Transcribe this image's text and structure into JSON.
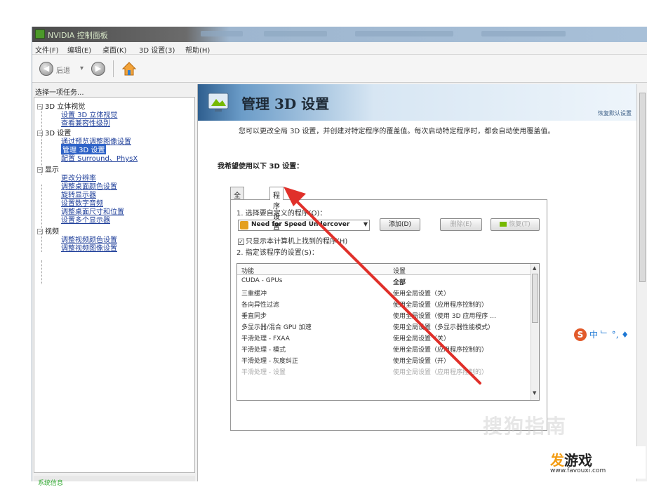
{
  "window": {
    "title": "NVIDIA 控制面板"
  },
  "menu": [
    "文件(F)",
    "编辑(E)",
    "桌面(K)",
    "3D 设置(3)",
    "帮助(H)"
  ],
  "toolbar": {
    "back_label": "后退",
    "back_glyph": "◀",
    "forward_glyph": "▶"
  },
  "tree": {
    "header": "选择一项任务...",
    "items": [
      {
        "label": "3D 立体视觉",
        "type": "category"
      },
      {
        "label": "设置 3D 立体视觉",
        "type": "link"
      },
      {
        "label": "查看兼容性级别",
        "type": "link"
      },
      {
        "label": "3D 设置",
        "type": "category"
      },
      {
        "label": "通过预览调整图像设置",
        "type": "link"
      },
      {
        "label": "管理 3D 设置",
        "type": "selected"
      },
      {
        "label": "配置 Surround、PhysX",
        "type": "link"
      },
      {
        "label": "显示",
        "type": "category"
      },
      {
        "label": "更改分辨率",
        "type": "link"
      },
      {
        "label": "调整桌面颜色设置",
        "type": "link"
      },
      {
        "label": "旋转显示器",
        "type": "link"
      },
      {
        "label": "设置数字音频",
        "type": "link"
      },
      {
        "label": "调整桌面尺寸和位置",
        "type": "link"
      },
      {
        "label": "设置多个显示器",
        "type": "link"
      },
      {
        "label": "视频",
        "type": "category"
      },
      {
        "label": "调整视频颜色设置",
        "type": "link"
      },
      {
        "label": "调整视频图像设置",
        "type": "link"
      }
    ],
    "expander_glyph": "−",
    "footer": "系统信息"
  },
  "main": {
    "title": "管理 3D 设置",
    "restore_link": "恢复默认设置",
    "description": "您可以更改全局 3D 设置，并创建对特定程序的覆盖值。每次启动特定程序时，都会自动使用覆盖值。",
    "section_title": "我希望使用以下 3D 设置：",
    "tabs": [
      "全局设置",
      "程序设置"
    ],
    "step1": "1. 选择要自定义的程序(O)：",
    "program": "Need for Speed Undercover",
    "add_button": "添加(D)",
    "remove_button": "删除(E)",
    "restore_button": "恢复(T)",
    "show_only_checkbox": "只显示本计算机上找到的程序(H)",
    "step2": "2. 指定该程序的设置(S)：",
    "columns": [
      "功能",
      "设置"
    ],
    "rows": [
      {
        "feature": "CUDA - GPUs",
        "value": "全部",
        "bold": true
      },
      {
        "feature": "三重缓冲",
        "value": "使用全局设置（关）"
      },
      {
        "feature": "各向异性过滤",
        "value": "使用全局设置（应用程序控制的）"
      },
      {
        "feature": "垂直同步",
        "value": "使用全局设置（使用 3D 应用程序 ..."
      },
      {
        "feature": "多显示器/混合 GPU 加速",
        "value": "使用全局设置（多显示器性能模式）"
      },
      {
        "feature": "平滑处理 - FXAA",
        "value": "使用全局设置（关）"
      },
      {
        "feature": "平滑处理 - 模式",
        "value": "使用全局设置（应用程序控制的）"
      },
      {
        "feature": "平滑处理 - 灰度纠正",
        "value": "使用全局设置（开）"
      },
      {
        "feature": "平滑处理 - 设置",
        "value": "使用全局设置（应用程序控制的）",
        "fade": true
      }
    ]
  },
  "ime": {
    "logo": "S",
    "text": "中 ﹂ °, ♦"
  },
  "watermark": {
    "sogou": "搜狗指南",
    "site_title_a": "发",
    "site_title_b": "游戏",
    "site_url": "www.favouxi.com"
  },
  "colors": {
    "arrow": "#e0302a",
    "selection": "#3064c8",
    "link": "#1f3f9a",
    "nvidia_green": "#76b900"
  }
}
